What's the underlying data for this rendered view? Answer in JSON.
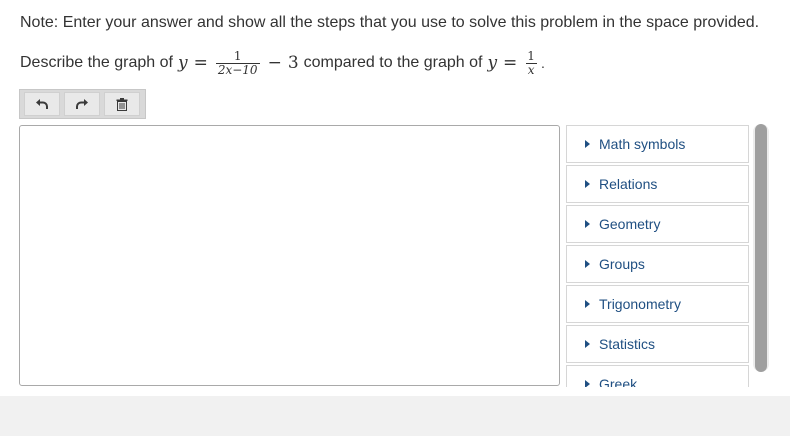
{
  "note": "Note: Enter your answer and show all the steps that you use to solve this problem in the space provided.",
  "question": {
    "prefix": "Describe the graph of",
    "var_y1": "y",
    "eq1": "=",
    "f1_num": "1",
    "f1_den": "2x−10",
    "minus": "−",
    "const": "3",
    "middle": "compared to the graph of",
    "var_y2": "y",
    "eq2": "=",
    "f2_num": "1",
    "f2_den": "x",
    "suffix": "."
  },
  "toolbar": {
    "undo_icon": "undo-icon",
    "redo_icon": "redo-icon",
    "delete_icon": "trash-icon"
  },
  "answer": {
    "value": ""
  },
  "palette": {
    "items": [
      {
        "label": "Math symbols"
      },
      {
        "label": "Relations"
      },
      {
        "label": "Geometry"
      },
      {
        "label": "Groups"
      },
      {
        "label": "Trigonometry"
      },
      {
        "label": "Statistics"
      },
      {
        "label": "Greek"
      }
    ]
  },
  "colors": {
    "palette_text": "#1f4f82",
    "toolbar_bg": "#d9d9d9",
    "scroll_thumb": "#9f9f9f"
  }
}
